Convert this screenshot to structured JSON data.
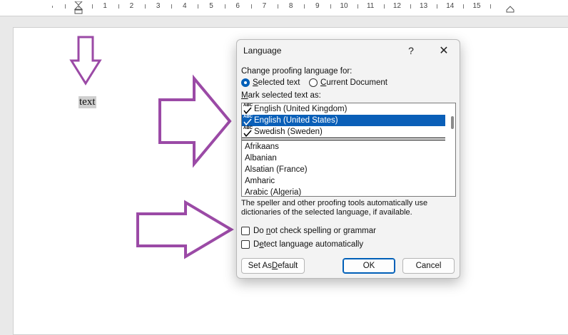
{
  "ruler": {
    "numbers": [
      "1",
      "2",
      "3",
      "4",
      "5",
      "6",
      "7",
      "8",
      "9",
      "10",
      "11",
      "12",
      "13",
      "14",
      "15"
    ]
  },
  "document": {
    "selected_text": "text"
  },
  "dialog": {
    "title": "Language",
    "help_glyph": "?",
    "close_glyph": "✕",
    "change_label": "Change proofing language for:",
    "radio_selected_text": "Selected text",
    "radio_current_document": "Current Document",
    "radio_checked": "selected_text",
    "mark_label": "Mark selected text as:",
    "preferred_languages": [
      "English (United Kingdom)",
      "English (United States)",
      "Swedish (Sweden)"
    ],
    "selected_language": "English (United States)",
    "other_languages": [
      "Afrikaans",
      "Albanian",
      "Alsatian (France)",
      "Amharic",
      "Arabic (Algeria)"
    ],
    "info_text": "The speller and other proofing tools automatically use dictionaries of the selected language, if available.",
    "checkbox_no_spell": "Do not check spelling or grammar",
    "checkbox_detect": "Detect language automatically",
    "btn_set_default": "Set As Default",
    "btn_ok": "OK",
    "btn_cancel": "Cancel"
  },
  "colors": {
    "accent": "#005fb8",
    "arrow": "#9b4aa6"
  }
}
